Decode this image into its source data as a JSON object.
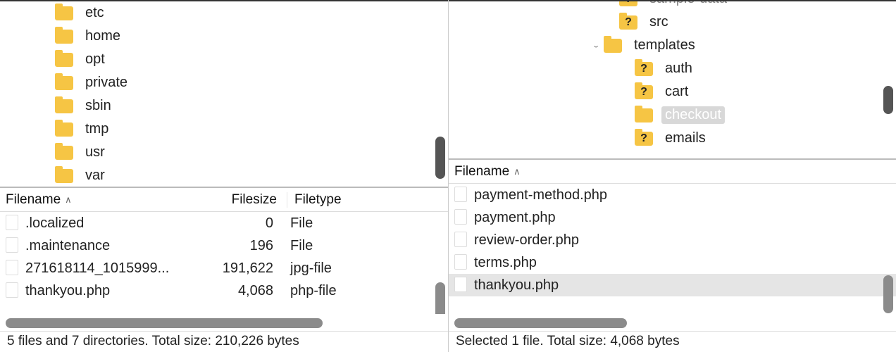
{
  "left": {
    "tree": [
      {
        "name": "etc",
        "indent": 68,
        "icon": "folder"
      },
      {
        "name": "home",
        "indent": 68,
        "icon": "folder"
      },
      {
        "name": "opt",
        "indent": 68,
        "icon": "folder"
      },
      {
        "name": "private",
        "indent": 68,
        "icon": "folder"
      },
      {
        "name": "sbin",
        "indent": 68,
        "icon": "folder"
      },
      {
        "name": "tmp",
        "indent": 68,
        "icon": "folder"
      },
      {
        "name": "usr",
        "indent": 68,
        "icon": "folder"
      },
      {
        "name": "var",
        "indent": 68,
        "icon": "folder"
      }
    ],
    "list": {
      "header_name": "Filename",
      "header_size": "Filesize",
      "header_type": "Filetype",
      "rows": [
        {
          "name": ".localized",
          "size": "0",
          "type": "File"
        },
        {
          "name": ".maintenance",
          "size": "196",
          "type": "File"
        },
        {
          "name": "271618114_1015999...",
          "size": "191,622",
          "type": "jpg-file"
        },
        {
          "name": "thankyou.php",
          "size": "4,068",
          "type": "php-file"
        }
      ]
    },
    "status": "5 files and 7 directories. Total size: 210,226 bytes"
  },
  "right": {
    "tree": [
      {
        "name": "sample-data",
        "indent": 862,
        "icon": "folder-q",
        "cut": true
      },
      {
        "name": "src",
        "indent": 862,
        "icon": "folder-q"
      },
      {
        "name": "templates",
        "indent": 862,
        "icon": "folder",
        "expanded": true
      },
      {
        "name": "auth",
        "indent": 884,
        "icon": "folder-q"
      },
      {
        "name": "cart",
        "indent": 884,
        "icon": "folder-q"
      },
      {
        "name": "checkout",
        "indent": 884,
        "icon": "folder",
        "selected": true
      },
      {
        "name": "emails",
        "indent": 884,
        "icon": "folder-q"
      }
    ],
    "list": {
      "header_name": "Filename",
      "rows": [
        {
          "name": "payment-method.php"
        },
        {
          "name": "payment.php"
        },
        {
          "name": "review-order.php"
        },
        {
          "name": "terms.php"
        },
        {
          "name": "thankyou.php",
          "selected": true
        }
      ]
    },
    "status": "Selected 1 file. Total size: 4,068 bytes"
  }
}
